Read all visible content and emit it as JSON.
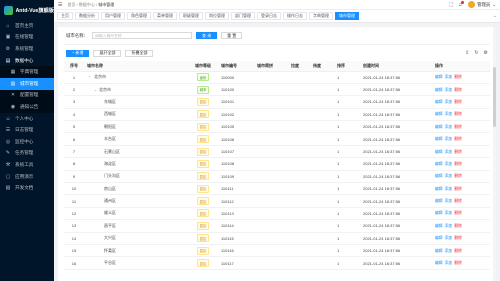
{
  "app": {
    "logo_text": "Antd-Vue旗舰版"
  },
  "sidebar": {
    "items": [
      {
        "label": "首页主页",
        "icon": "home-icon",
        "glyph": "⌂",
        "state": "normal"
      },
      {
        "label": "在线管理",
        "icon": "monitor-icon",
        "glyph": "▣",
        "state": "normal"
      },
      {
        "label": "系统管理",
        "icon": "setting-icon",
        "glyph": "⚙",
        "state": "normal"
      },
      {
        "label": "数据中心",
        "icon": "database-icon",
        "glyph": "▤",
        "state": "open"
      },
      {
        "label": "字典管理",
        "icon": "book-icon",
        "glyph": "▦",
        "state": "sub"
      },
      {
        "label": "城市管理",
        "icon": "city-icon",
        "glyph": "▥",
        "state": "active"
      },
      {
        "label": "配置管理",
        "icon": "config-icon",
        "glyph": "✕",
        "state": "sub"
      },
      {
        "label": "通知公告",
        "icon": "notice-icon",
        "glyph": "◉",
        "state": "sub"
      },
      {
        "label": "个人中心",
        "icon": "user-icon",
        "glyph": "☺",
        "state": "normal"
      },
      {
        "label": "日志管理",
        "icon": "log-icon",
        "glyph": "☰",
        "state": "normal"
      },
      {
        "label": "监控中心",
        "icon": "eye-icon",
        "glyph": "◎",
        "state": "normal"
      },
      {
        "label": "任务管理",
        "icon": "task-icon",
        "glyph": "✎",
        "state": "normal"
      },
      {
        "label": "系统工具",
        "icon": "tool-icon",
        "glyph": "⚒",
        "state": "normal"
      },
      {
        "label": "应用演示",
        "icon": "app-icon",
        "glyph": "▢",
        "state": "normal"
      },
      {
        "label": "开发文档",
        "icon": "doc-icon",
        "glyph": "▧",
        "state": "normal"
      }
    ]
  },
  "header": {
    "breadcrumb": {
      "home": "首页",
      "sep1": "/",
      "parent": "数据中心",
      "sep2": "/",
      "current": "城市管理"
    },
    "user_name": "管理员"
  },
  "tabs": [
    "主页",
    "数据分析",
    "用户管理",
    "角色管理",
    "菜单管理",
    "职级管理",
    "岗位管理",
    "部门管理",
    "登录日志",
    "操作日志",
    "字典管理",
    "城市管理"
  ],
  "active_tab": 11,
  "search": {
    "label": "城市名称：",
    "placeholder": "请输入城市名称",
    "query_label": "查 询",
    "reset_label": "重 置"
  },
  "toolbar": {
    "add_label": "+ 新增",
    "expand_label": "展开全部",
    "collapse_label": "折叠全部"
  },
  "table": {
    "columns": [
      "序号",
      "城市名称",
      "城市等级",
      "城市编号",
      "城市简拼",
      "拉度",
      "纬度",
      "排序",
      "创建时间",
      "操作"
    ],
    "actions": {
      "edit": "编辑",
      "add": "添加",
      "delete": "删除"
    },
    "rows": [
      {
        "no": "1",
        "name": "北京市",
        "level": "省份",
        "level_color": "green",
        "code": "110000",
        "level_depth": 0,
        "expand": "›",
        "sort": "1",
        "created": "2021-01-24 18:37:56"
      },
      {
        "no": "2",
        "name": "北京市",
        "level": "城市",
        "level_color": "green",
        "code": "110100",
        "level_depth": 1,
        "expand": "⌄",
        "sort": "1",
        "created": "2021-01-24 18:37:56"
      },
      {
        "no": "3",
        "name": "东城区",
        "level": "县区",
        "level_color": "yellow",
        "code": "110101",
        "level_depth": 2,
        "expand": "",
        "sort": "1",
        "created": "2021-01-24 18:37:56"
      },
      {
        "no": "4",
        "name": "西城区",
        "level": "县区",
        "level_color": "yellow",
        "code": "110102",
        "level_depth": 2,
        "expand": "",
        "sort": "1",
        "created": "2021-01-24 18:37:56"
      },
      {
        "no": "5",
        "name": "朝阳区",
        "level": "县区",
        "level_color": "yellow",
        "code": "110105",
        "level_depth": 2,
        "expand": "",
        "sort": "1",
        "created": "2021-01-24 18:37:56"
      },
      {
        "no": "6",
        "name": "丰台区",
        "level": "县区",
        "level_color": "yellow",
        "code": "110106",
        "level_depth": 2,
        "expand": "",
        "sort": "1",
        "created": "2021-01-24 18:37:56"
      },
      {
        "no": "7",
        "name": "石景山区",
        "level": "县区",
        "level_color": "yellow",
        "code": "110107",
        "level_depth": 2,
        "expand": "",
        "sort": "1",
        "created": "2021-01-24 18:37:56"
      },
      {
        "no": "8",
        "name": "海淀区",
        "level": "县区",
        "level_color": "yellow",
        "code": "110108",
        "level_depth": 2,
        "expand": "",
        "sort": "1",
        "created": "2021-01-24 18:37:56"
      },
      {
        "no": "9",
        "name": "门头沟区",
        "level": "县区",
        "level_color": "yellow",
        "code": "110109",
        "level_depth": 2,
        "expand": "",
        "sort": "1",
        "created": "2021-01-24 18:37:56"
      },
      {
        "no": "10",
        "name": "房山区",
        "level": "县区",
        "level_color": "yellow",
        "code": "110111",
        "level_depth": 2,
        "expand": "",
        "sort": "1",
        "created": "2021-01-24 18:37:56"
      },
      {
        "no": "11",
        "name": "通州区",
        "level": "县区",
        "level_color": "yellow",
        "code": "110112",
        "level_depth": 2,
        "expand": "",
        "sort": "1",
        "created": "2021-01-24 18:37:56"
      },
      {
        "no": "12",
        "name": "顺义区",
        "level": "县区",
        "level_color": "yellow",
        "code": "110113",
        "level_depth": 2,
        "expand": "",
        "sort": "1",
        "created": "2021-01-24 18:37:56"
      },
      {
        "no": "13",
        "name": "昌平区",
        "level": "县区",
        "level_color": "yellow",
        "code": "110114",
        "level_depth": 2,
        "expand": "",
        "sort": "1",
        "created": "2021-01-24 18:37:56"
      },
      {
        "no": "14",
        "name": "大兴区",
        "level": "县区",
        "level_color": "yellow",
        "code": "110115",
        "level_depth": 2,
        "expand": "",
        "sort": "1",
        "created": "2021-01-24 18:37:56"
      },
      {
        "no": "15",
        "name": "怀柔区",
        "level": "县区",
        "level_color": "yellow",
        "code": "110116",
        "level_depth": 2,
        "expand": "",
        "sort": "1",
        "created": "2021-01-24 18:37:56"
      },
      {
        "no": "16",
        "name": "平谷区",
        "level": "县区",
        "level_color": "yellow",
        "code": "110117",
        "level_depth": 2,
        "expand": "",
        "sort": "1",
        "created": "2021-01-24 18:37:56"
      }
    ]
  },
  "colors": {
    "primary": "#1890ff",
    "sidebar_bg": "#001529",
    "danger": "#f5222d"
  }
}
